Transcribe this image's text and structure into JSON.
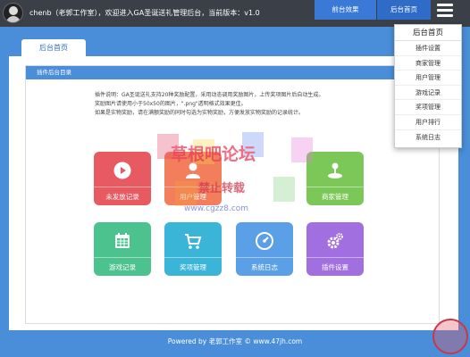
{
  "header": {
    "welcome": "chenb（老郭工作室），欢迎进入GA圣诞送礼管理后台，当前版本：v1.0",
    "front_btn": "前台效果",
    "home_btn": "后台首页"
  },
  "dropdown": {
    "title": "后台首页",
    "items": [
      "插件设置",
      "商家管理",
      "用户管理",
      "游戏记录",
      "奖项管理",
      "用户排行",
      "系统日志"
    ]
  },
  "tab": {
    "label": "后台首页"
  },
  "panel": {
    "heading": "插件后台目录",
    "desc": [
      "插件说明：GA圣诞送礼支持20种奖励配置，采用动态调用奖励图片，上传奖项图片后自动生成。",
      "奖励图片请使用小于50x50的图片，\".png\"透明格式效果更佳。",
      "如果是实物奖励，请在满额奖励的同时勾选为实物奖励，方便发放实物奖励的记录统计。"
    ]
  },
  "tiles": [
    {
      "label": "未发放记录",
      "color": "#e85a62"
    },
    {
      "label": "用户管理",
      "color": "#f27e5b"
    },
    {
      "label": "商家管理",
      "color": "#7bc858"
    },
    {
      "label": "游戏记录",
      "color": "#4cc28f"
    },
    {
      "label": "奖项管理",
      "color": "#3ab5d8"
    },
    {
      "label": "系统日志",
      "color": "#5b9fe6"
    },
    {
      "label": "插件设置",
      "color": "#a26fe0"
    }
  ],
  "watermark": {
    "line1": "草根吧论坛",
    "line2": "禁止转载",
    "line3": "www.cgzz8.com"
  },
  "footer": "Powered by 老郭工作室 © www.47jh.com"
}
